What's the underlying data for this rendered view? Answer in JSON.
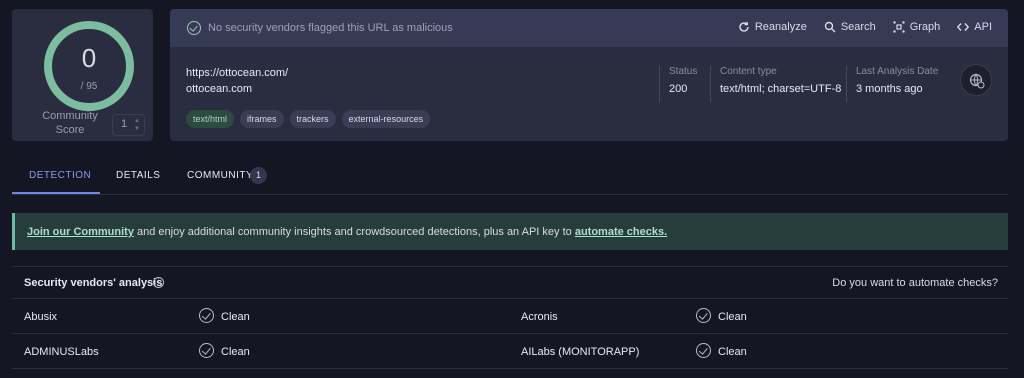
{
  "score": {
    "detections": "0",
    "total": "/ 95",
    "community_label": "Community Score",
    "community_value": "1"
  },
  "header": {
    "flag_text": "No security vendors flagged this URL as malicious",
    "actions": [
      "Reanalyze",
      "Search",
      "Graph",
      "API"
    ]
  },
  "url": {
    "full": "https://ottocean.com/",
    "domain": "ottocean.com"
  },
  "tags": [
    "text/html",
    "iframes",
    "trackers",
    "external-resources"
  ],
  "meta": {
    "status_label": "Status",
    "status_value": "200",
    "content_type_label": "Content type",
    "content_type_value": "text/html; charset=UTF-8",
    "last_analysis_label": "Last Analysis Date",
    "last_analysis_value": "3 months ago"
  },
  "tabs": {
    "detection": "DETECTION",
    "details": "DETAILS",
    "community": "COMMUNITY",
    "community_count": "1"
  },
  "banner": {
    "join_link": "Join our Community",
    "middle": " and enjoy additional community insights and crowdsourced detections, plus an API key to ",
    "automate_link": "automate checks."
  },
  "vendors": {
    "title": "Security vendors' analysis",
    "automate_prompt": "Do you want to automate checks?",
    "rows": [
      {
        "left_name": "Abusix",
        "left_status": "Clean",
        "right_name": "Acronis",
        "right_status": "Clean"
      },
      {
        "left_name": "ADMINUSLabs",
        "left_status": "Clean",
        "right_name": "AILabs (MONITORAPP)",
        "right_status": "Clean"
      }
    ]
  },
  "colors": {
    "background": "#151624",
    "card": "#2a2c40",
    "score_ring": "#7dbd9f",
    "accent_tab": "#6f83e8",
    "banner_bg": "#273d3b"
  }
}
